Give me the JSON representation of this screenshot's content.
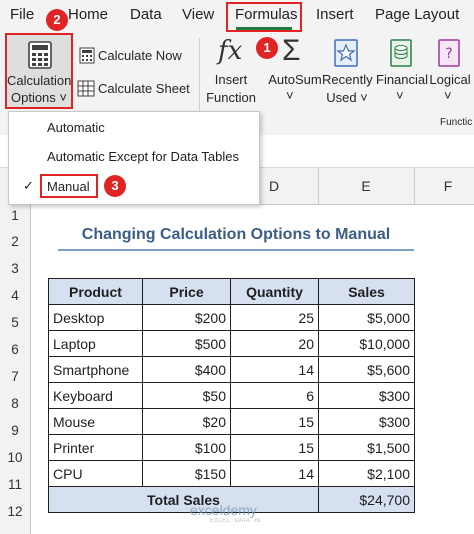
{
  "ribbon": {
    "tabs": [
      "File",
      "Home",
      "Data",
      "View",
      "Formulas",
      "Insert",
      "Page Layout"
    ],
    "buttons": {
      "calc_options_line1": "Calculation",
      "calc_options_line2": "Options ˅",
      "calculate_now": "Calculate Now",
      "calculate_sheet": "Calculate Sheet",
      "insert_function_line1": "Insert",
      "insert_function_line2": "Function",
      "autosum": "AutoSum",
      "autosum_caret": "˅",
      "recently_used_line1": "Recently",
      "recently_used_line2": "Used ˅",
      "financial": "Financial",
      "financial_caret": "˅",
      "logical": "Logical",
      "logical_caret": "˅",
      "group_label": "Functic"
    },
    "accent_color": "#1e7a40",
    "highlight_color": "#e02424"
  },
  "badges": {
    "formulas_tab": "1",
    "calc_options": "2",
    "manual": "3"
  },
  "dropdown": {
    "items": [
      "Automatic",
      "Automatic Except for Data Tables",
      "Manual"
    ],
    "checked_item": "Manual",
    "check_glyph": "✓"
  },
  "sheet": {
    "columns": [
      "D",
      "E",
      "F"
    ],
    "rows": [
      "1",
      "2",
      "3",
      "4",
      "5",
      "6",
      "7",
      "8",
      "9",
      "10",
      "11",
      "12"
    ],
    "title": "Changing Calculation Options to Manual",
    "table": {
      "headers": [
        "Product",
        "Price",
        "Quantity",
        "Sales"
      ],
      "rows": [
        [
          "Desktop",
          "$200",
          "25",
          "$5,000"
        ],
        [
          "Laptop",
          "$500",
          "20",
          "$10,000"
        ],
        [
          "Smartphone",
          "$400",
          "14",
          "$5,600"
        ],
        [
          "Keyboard",
          "$50",
          "6",
          "$300"
        ],
        [
          "Mouse",
          "$20",
          "15",
          "$300"
        ],
        [
          "Printer",
          "$100",
          "15",
          "$1,500"
        ],
        [
          "CPU",
          "$150",
          "14",
          "$2,100"
        ]
      ],
      "total_label": "Total Sales",
      "total_value": "$24,700"
    }
  },
  "watermark": {
    "name": "exceldemy",
    "tagline": "EXCEL · DATA · BI"
  }
}
